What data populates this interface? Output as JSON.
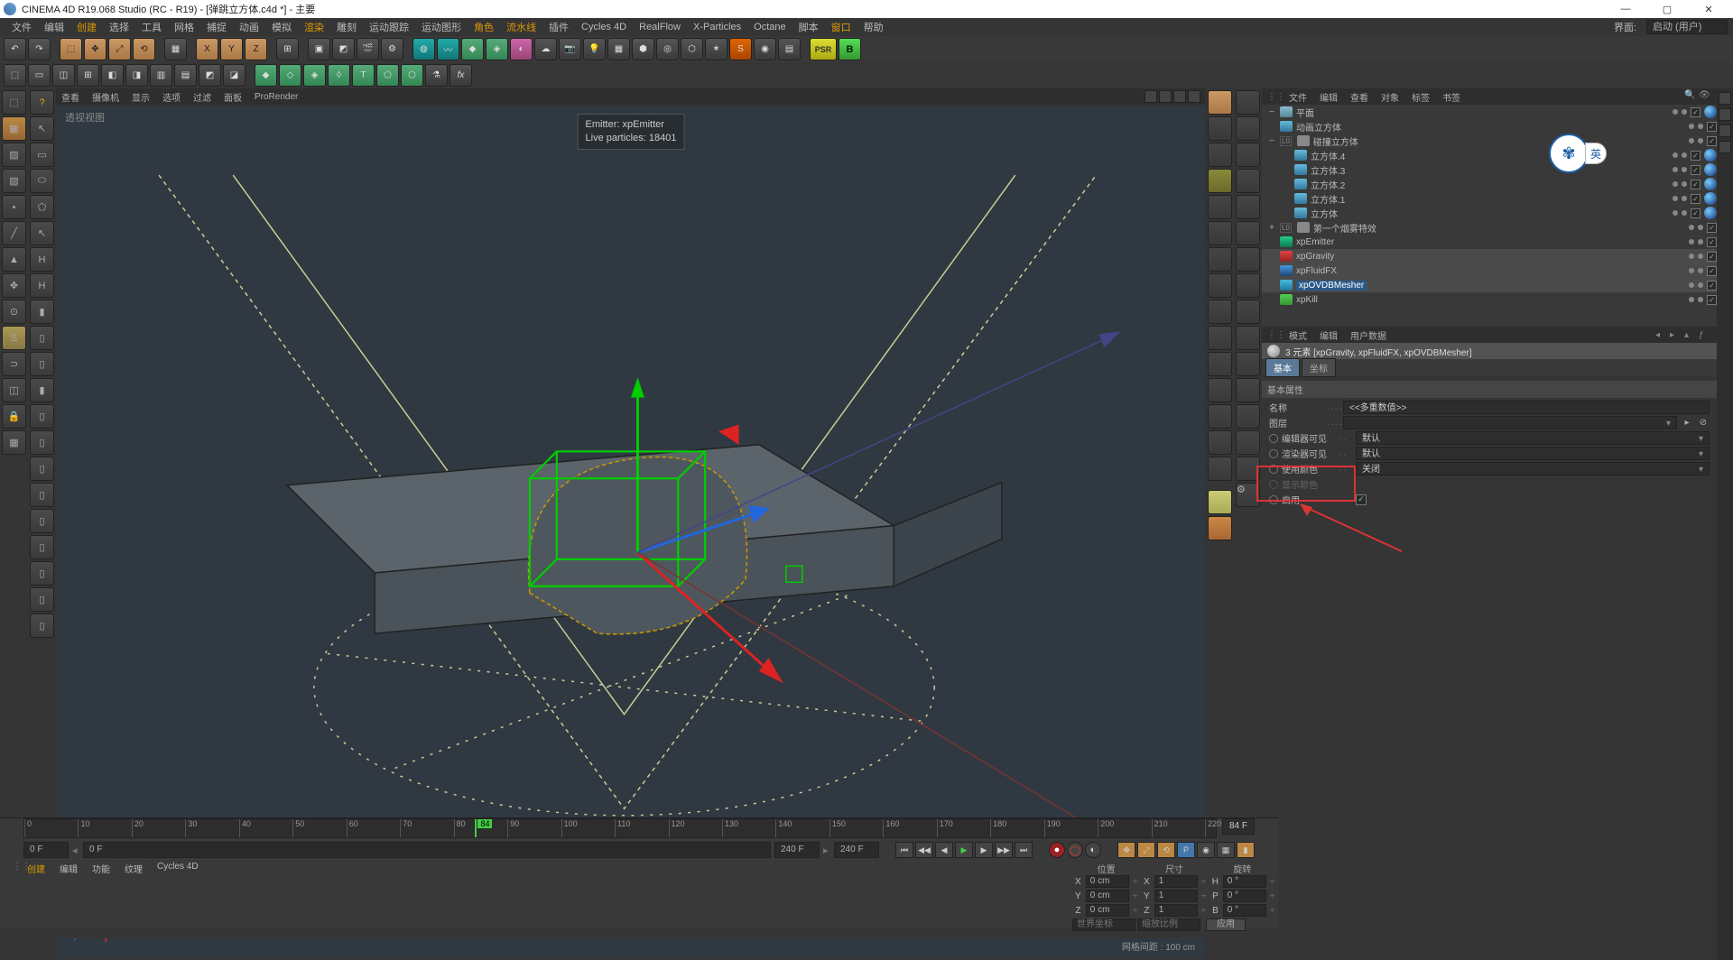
{
  "title": "CINEMA 4D R19.068 Studio (RC - R19) - [弹跳立方体.c4d *] - 主要",
  "menu": [
    "文件",
    "编辑",
    "创建",
    "选择",
    "工具",
    "网格",
    "捕捉",
    "动画",
    "模拟",
    "渲染",
    "雕刻",
    "运动跟踪",
    "运动图形",
    "角色",
    "流水线",
    "插件",
    "Cycles 4D",
    "RealFlow",
    "X-Particles",
    "Octane",
    "脚本",
    "窗口",
    "帮助"
  ],
  "layoutLabel": "界面:",
  "layoutValue": "启动 (用户)",
  "viewMenu": [
    "查看",
    "摄像机",
    "显示",
    "选项",
    "过滤",
    "面板",
    "ProRender"
  ],
  "viewportTitle": "透视视图",
  "hud": {
    "l1": "Emitter: xpEmitter",
    "l2": "Live particles: 18401"
  },
  "gridLabel": "网格间距 : 100 cm",
  "objTabs": [
    "文件",
    "编辑",
    "查看",
    "对象",
    "标签",
    "书签"
  ],
  "tree": [
    {
      "lvl": 0,
      "exp": "−",
      "name": "平面",
      "ic": "ic-plane",
      "tags": 1
    },
    {
      "lvl": 0,
      "exp": "",
      "name": "动画立方体",
      "ic": "ic-cube",
      "tags": 0
    },
    {
      "lvl": 0,
      "exp": "−",
      "name": "碰撞立方体",
      "ic": "ic-null",
      "tags": 0,
      "pre": "L0"
    },
    {
      "lvl": 1,
      "exp": "",
      "name": "立方体.4",
      "ic": "ic-cube",
      "tags": 1
    },
    {
      "lvl": 1,
      "exp": "",
      "name": "立方体.3",
      "ic": "ic-cube",
      "tags": 1
    },
    {
      "lvl": 1,
      "exp": "",
      "name": "立方体.2",
      "ic": "ic-cube",
      "tags": 1
    },
    {
      "lvl": 1,
      "exp": "",
      "name": "立方体.1",
      "ic": "ic-cube",
      "tags": 1
    },
    {
      "lvl": 1,
      "exp": "",
      "name": "立方体",
      "ic": "ic-cube",
      "tags": 1
    },
    {
      "lvl": 0,
      "exp": "+",
      "name": "第一个烟雾特效",
      "ic": "ic-null",
      "tags": 0,
      "pre": "L0"
    },
    {
      "lvl": 0,
      "exp": "",
      "name": "xpEmitter",
      "ic": "ic-emit",
      "tags": 0
    },
    {
      "lvl": 0,
      "exp": "",
      "name": "xpGravity",
      "ic": "ic-grav",
      "tags": 0,
      "sel": true
    },
    {
      "lvl": 0,
      "exp": "",
      "name": "xpFluidFX",
      "ic": "ic-fluid",
      "tags": 0,
      "sel": true
    },
    {
      "lvl": 0,
      "exp": "",
      "name": "xpOVDBMesher",
      "ic": "ic-mesh",
      "tags": 0,
      "sel": true,
      "selblue": true
    },
    {
      "lvl": 0,
      "exp": "",
      "name": "xpKill",
      "ic": "ic-kill",
      "tags": 0
    }
  ],
  "attrTabs": [
    "模式",
    "编辑",
    "用户数据"
  ],
  "attrHeader": "3 元素 [xpGravity, xpFluidFX, xpOVDBMesher]",
  "attrSubTabs": [
    "基本",
    "坐标"
  ],
  "attrSection": "基本属性",
  "props": {
    "nameLabel": "名称",
    "nameVal": "<<多重数值>>",
    "layerLabel": "图层",
    "layerVal": "",
    "editLabel": "编辑器可见",
    "editVal": "默认",
    "renderLabel": "渲染器可见",
    "renderVal": "默认",
    "colorUseLabel": "使用颜色",
    "colorUseVal": "关闭",
    "colorLabel": "显示颜色",
    "enableLabel": "启用"
  },
  "timeline": {
    "start": 0,
    "end": 240,
    "current": 84,
    "ticks": [
      0,
      10,
      20,
      30,
      40,
      50,
      60,
      70,
      80,
      90,
      100,
      110,
      120,
      130,
      140,
      150,
      160,
      170,
      180,
      190,
      200,
      210,
      220
    ],
    "frameField": "84 F",
    "startField": "0 F",
    "rangeStart": "0 F",
    "rangeEnd": "240 F",
    "endField": "240 F"
  },
  "coordTabs": [
    "创建",
    "编辑",
    "功能",
    "纹理",
    "Cycles 4D"
  ],
  "coord": {
    "hdr": [
      "位置",
      "尺寸",
      "旋转"
    ],
    "rows": [
      {
        "ax": "X",
        "p": "0 cm",
        "s": "1",
        "r": "0 °",
        "sl": "X",
        "rl": "H"
      },
      {
        "ax": "Y",
        "p": "0 cm",
        "s": "1",
        "r": "0 °",
        "sl": "Y",
        "rl": "P"
      },
      {
        "ax": "Z",
        "p": "0 cm",
        "s": "1",
        "r": "0 °",
        "sl": "Z",
        "rl": "B"
      }
    ],
    "space": "世界坐标",
    "scaleMode": "缩放比例",
    "apply": "应用"
  },
  "psr": "PSR",
  "badgeLang": "英"
}
